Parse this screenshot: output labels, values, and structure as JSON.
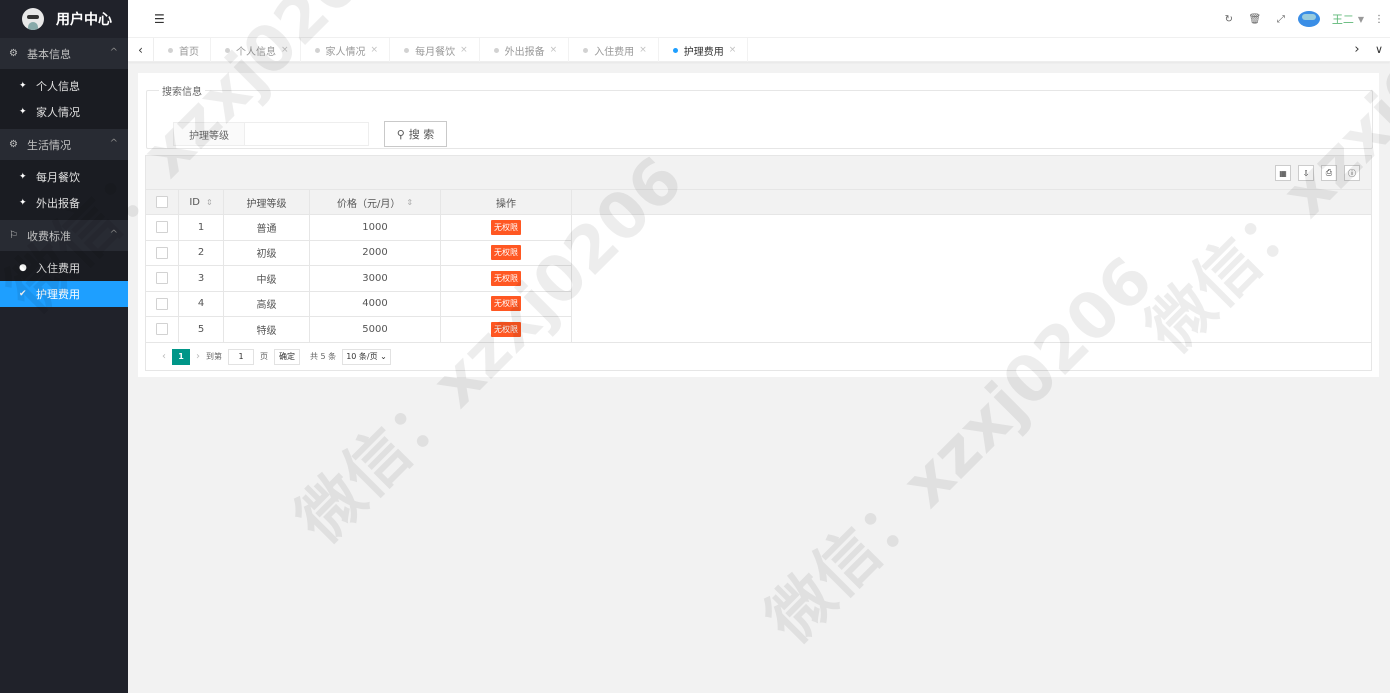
{
  "app": {
    "title": "用户中心"
  },
  "sidebar": {
    "groups": [
      {
        "label": "基本信息",
        "items": [
          "个人信息",
          "家人情况"
        ]
      },
      {
        "label": "生活情况",
        "items": [
          "每月餐饮",
          "外出报备"
        ]
      },
      {
        "label": "收费标准",
        "items": [
          "入住费用",
          "护理费用"
        ]
      }
    ],
    "active_item": "护理费用"
  },
  "header": {
    "user": "王二"
  },
  "tabs": [
    {
      "label": "首页",
      "closable": false
    },
    {
      "label": "个人信息",
      "closable": true
    },
    {
      "label": "家人情况",
      "closable": true
    },
    {
      "label": "每月餐饮",
      "closable": true
    },
    {
      "label": "外出报备",
      "closable": true
    },
    {
      "label": "入住费用",
      "closable": true
    },
    {
      "label": "护理费用",
      "closable": true,
      "active": true
    }
  ],
  "search": {
    "legend": "搜索信息",
    "label": "护理等级",
    "value": "",
    "button": "搜 索"
  },
  "table": {
    "columns": [
      "ID",
      "护理等级",
      "价格（元/月）",
      "操作"
    ],
    "rows": [
      {
        "id": "1",
        "level": "普通",
        "price": "1000",
        "action": "无权限"
      },
      {
        "id": "2",
        "level": "初级",
        "price": "2000",
        "action": "无权限"
      },
      {
        "id": "3",
        "level": "中级",
        "price": "3000",
        "action": "无权限"
      },
      {
        "id": "4",
        "level": "高级",
        "price": "4000",
        "action": "无权限"
      },
      {
        "id": "5",
        "level": "特级",
        "price": "5000",
        "action": "无权限"
      }
    ]
  },
  "pager": {
    "current": "1",
    "goto_label": "到第",
    "goto_value": "1",
    "page_unit": "页",
    "confirm": "确定",
    "total": "共 5 条",
    "per_page": "10 条/页"
  },
  "watermark": "微信：xzxj0206",
  "colors": {
    "sidebar_bg": "#20222a",
    "active_blue": "#1e9fff",
    "badge": "#ff5722",
    "pager_active": "#009688"
  }
}
